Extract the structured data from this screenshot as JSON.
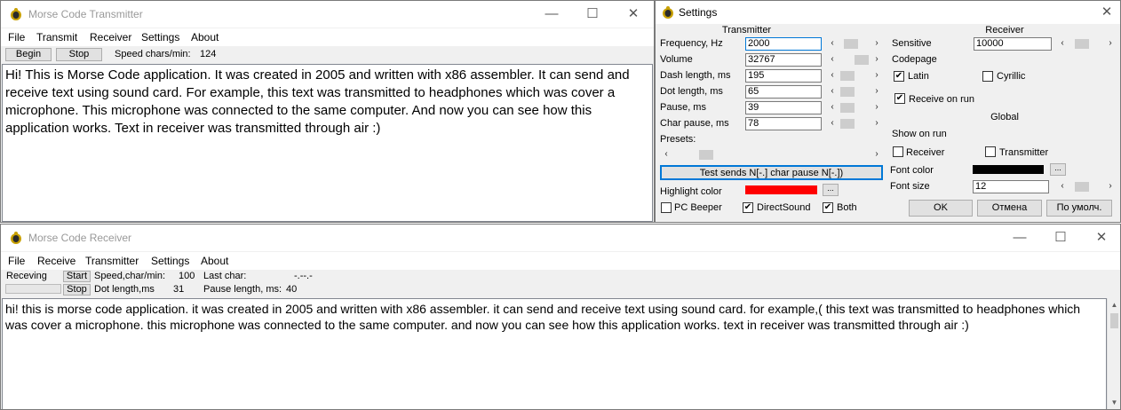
{
  "transmitter": {
    "title": "Morse Code Transmitter",
    "menu": [
      "File",
      "Transmit",
      "Receiver",
      "Settings",
      "About"
    ],
    "begin_label": "Begin",
    "stop_label": "Stop",
    "speed_label": "Speed chars/min:",
    "speed_value": "124",
    "text": "Hi! This is Morse Code application. It was created in 2005 and written with x86 assembler. It can send and receive text using sound card. For example, this text was transmitted to headphones which was cover a microphone. This microphone was connected to the same computer. And now you can see how this application works. Text in receiver was transmitted through air :)"
  },
  "receiver": {
    "title": "Morse Code Receiver",
    "menu": [
      "File",
      "Receive",
      "Transmitter",
      "Settings",
      "About"
    ],
    "status_label": "Receving",
    "start_label": "Start",
    "stop_label": "Stop",
    "speed_label": "Speed,char/min:",
    "speed_value": "100",
    "last_char_label": "Last char:",
    "last_char_value": "-.--.-",
    "dot_length_label": "Dot length,ms",
    "dot_length_value": "31",
    "pause_length_label": "Pause length, ms:",
    "pause_length_value": "40",
    "text": "hi! this is morse code application. it was created in 2005 and written with x86 assembler. it can send and receive text using sound card. for example,(  this text was transmitted to headphones which was cover a microphone. this microphone was connected to the same computer. and now you can see how this application works. text in receiver was transmitted through air :)"
  },
  "settings": {
    "title": "Settings",
    "transmitter_header": "Transmitter",
    "receiver_header": "Receiver",
    "global_header": "Global",
    "frequency_label": "Frequency, Hz",
    "frequency_value": "2000",
    "volume_label": "Volume",
    "volume_value": "32767",
    "dash_length_label": "Dash length, ms",
    "dash_length_value": "195",
    "dot_length_label": "Dot length, ms",
    "dot_length_value": "65",
    "pause_label": "Pause, ms",
    "pause_value": "39",
    "char_pause_label": "Char pause, ms",
    "char_pause_value": "78",
    "presets_label": "Presets:",
    "test_button_label": "Test sends N[-.]  char pause N[-.])",
    "highlight_color_label": "Highlight color",
    "highlight_color": "#ff0000",
    "pc_beeper_label": "PC Beeper",
    "pc_beeper_checked": false,
    "direct_sound_label": "DirectSound",
    "direct_sound_checked": true,
    "both_label": "Both",
    "both_checked": true,
    "sensitive_label": "Sensitive",
    "sensitive_value": "10000",
    "codepage_label": "Codepage",
    "latin_label": "Latin",
    "latin_checked": true,
    "cyrillic_label": "Cyrillic",
    "cyrillic_checked": false,
    "receive_on_run_label": "Receive on run",
    "receive_on_run_checked": true,
    "show_on_run_label": "Show on run",
    "show_receiver_label": "Receiver",
    "show_receiver_checked": false,
    "show_transmitter_label": "Transmitter",
    "show_transmitter_checked": false,
    "font_color_label": "Font color",
    "font_color": "#000000",
    "font_size_label": "Font size",
    "font_size_value": "12",
    "ok_label": "OK",
    "cancel_label": "Отмена",
    "default_label": "По умолч.",
    "browse_label": "...",
    "close_glyph": "✕"
  },
  "icons": {
    "app_icon": "morse-app-icon",
    "minimize": "minimize-icon",
    "maximize": "maximize-icon",
    "close": "close-icon",
    "arrow_left": "‹",
    "arrow_right": "›"
  },
  "colors": {
    "window_bg": "#f0f0f0",
    "focus_border": "#0078d7",
    "title_inactive": "#999999"
  }
}
